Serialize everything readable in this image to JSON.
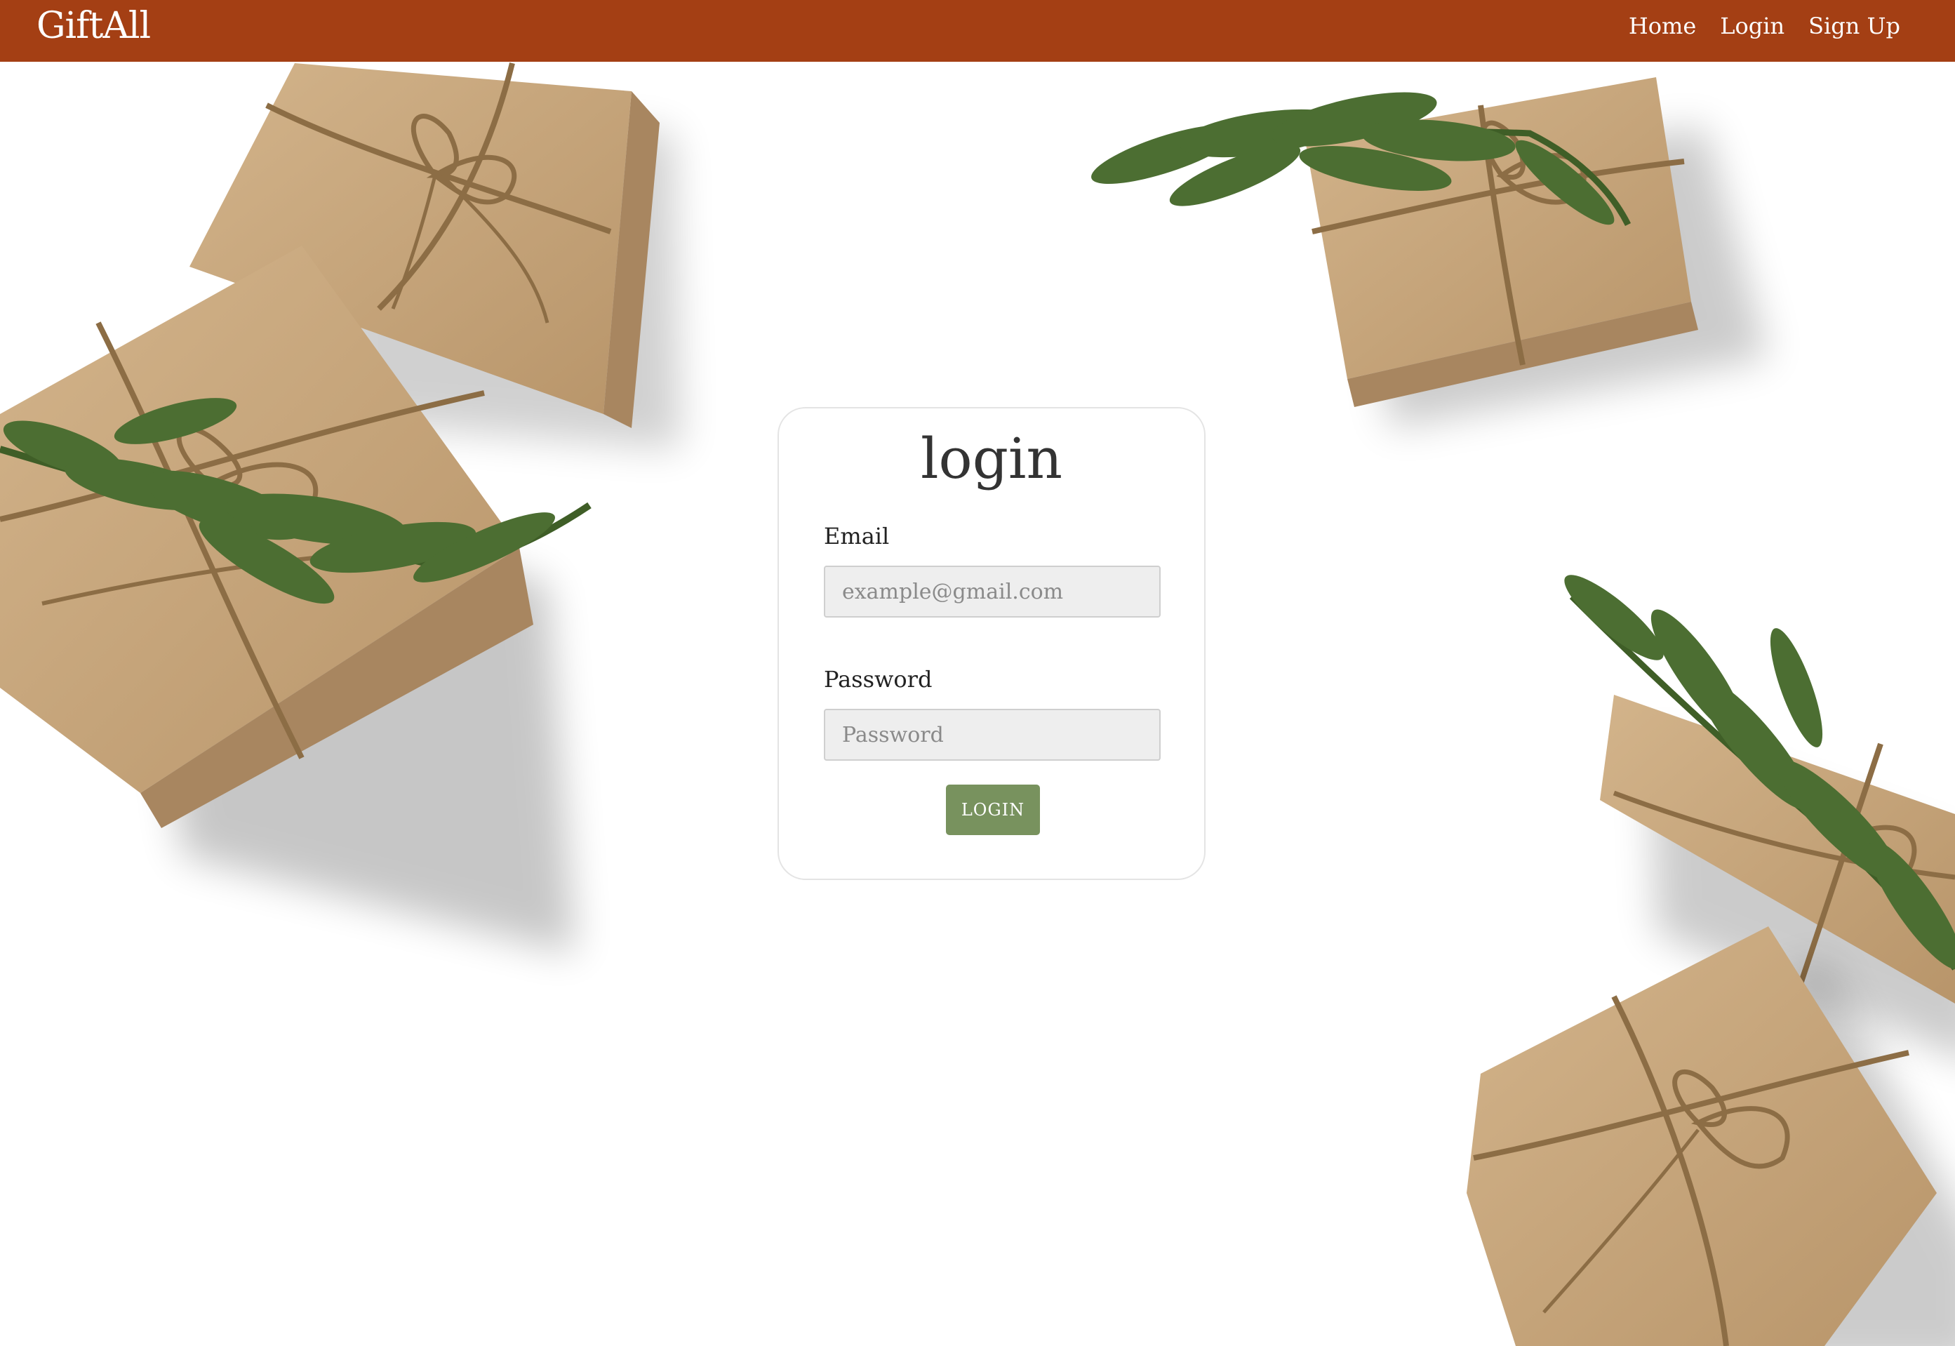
{
  "navbar": {
    "brand": "GiftAll",
    "links": [
      "Home",
      "Login",
      "Sign Up"
    ]
  },
  "login_card": {
    "title": "login",
    "email_label": "Email",
    "email_placeholder": "example@gmail.com",
    "password_label": "Password",
    "password_placeholder": "Password",
    "submit_label": "LOGIN"
  },
  "colors": {
    "navbar_bg": "#a43f14",
    "button_bg": "#78925e",
    "kraft_paper": "#c9a77c",
    "twine": "#a8875a",
    "greenery": "#4c6e32"
  },
  "background": {
    "decor": "kraft-paper-gift-boxes-with-twine-and-greenery"
  }
}
